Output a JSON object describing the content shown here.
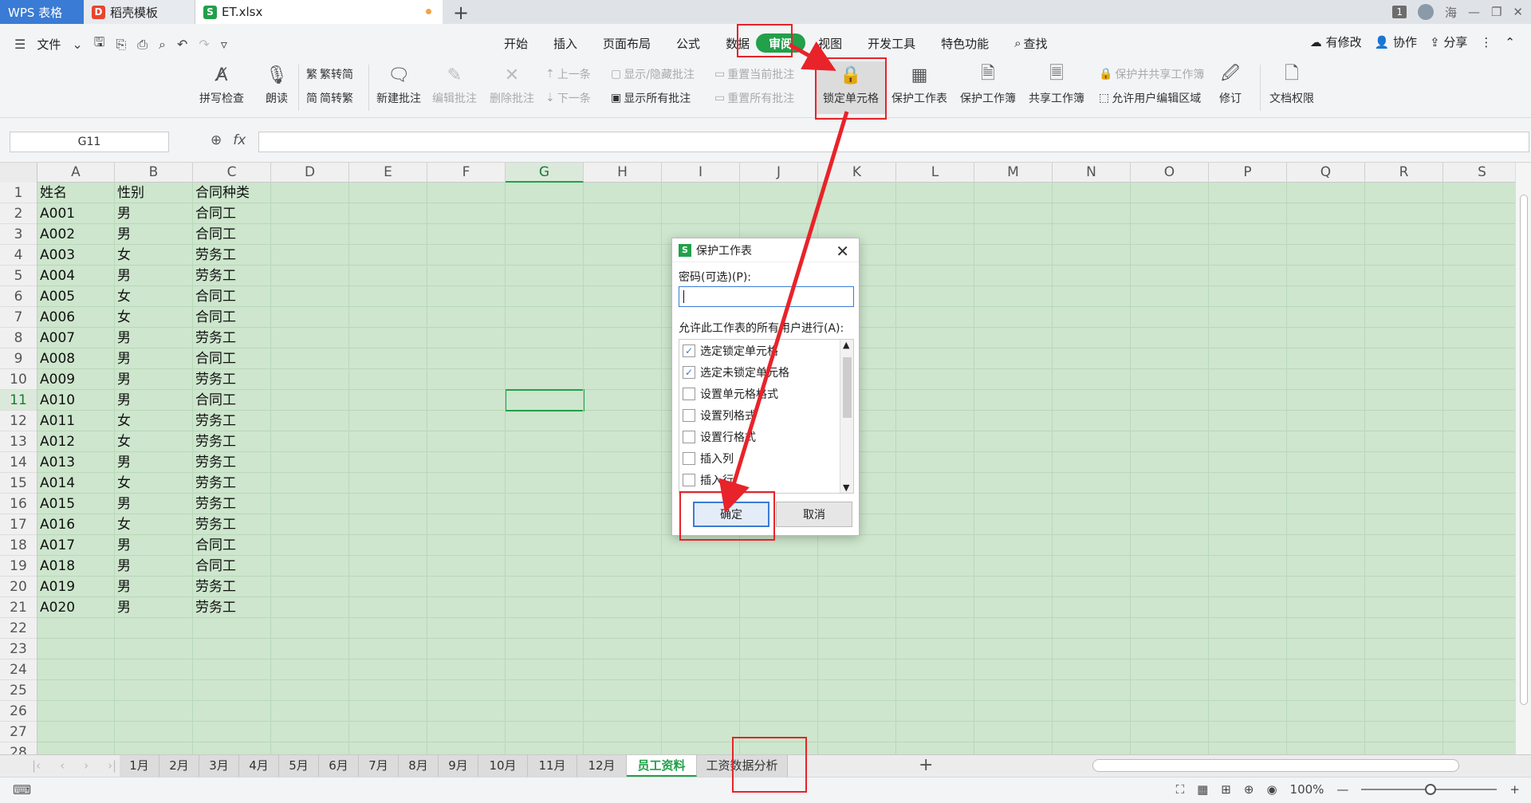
{
  "tabs": [
    {
      "label": "WPS 表格"
    },
    {
      "label": "稻壳模板"
    },
    {
      "label": "ET.xlsx"
    }
  ],
  "titlebar": {
    "window_badge": "1",
    "user": "海"
  },
  "menu": {
    "file": "文件",
    "tabs": [
      "开始",
      "插入",
      "页面布局",
      "公式",
      "数据",
      "审阅",
      "视图",
      "开发工具",
      "特色功能"
    ],
    "search": "查找",
    "right": [
      "有修改",
      "协作",
      "分享"
    ]
  },
  "ribbon": {
    "spell": "拼写检查",
    "read": "朗读",
    "trad": "繁转简",
    "simp": "简转繁",
    "new_comment": "新建批注",
    "edit_comment": "编辑批注",
    "delete_comment": "删除批注",
    "prev": "上一条",
    "next": "下一条",
    "show_hide": "显示/隐藏批注",
    "show_all": "显示所有批注",
    "reset_current": "重置当前批注",
    "reset_all": "重置所有批注",
    "lock_cell": "锁定单元格",
    "protect_sheet": "保护工作表",
    "protect_book": "保护工作簿",
    "share_book": "共享工作簿",
    "protect_share": "保护并共享工作簿",
    "allow_edit": "允许用户编辑区域",
    "revise": "修订",
    "doc_rights": "文档权限"
  },
  "formula": {
    "namebox": "G11",
    "fx": "fx"
  },
  "grid": {
    "columns": [
      "A",
      "B",
      "C",
      "D",
      "E",
      "F",
      "G",
      "H",
      "I",
      "J",
      "K",
      "L",
      "M",
      "N",
      "O",
      "P",
      "Q",
      "R",
      "S"
    ],
    "row_numbers": [
      "1",
      "2",
      "3",
      "4",
      "5",
      "6",
      "7",
      "8",
      "9",
      "10",
      "11",
      "12",
      "13",
      "14",
      "15",
      "16",
      "17",
      "18",
      "19",
      "20",
      "21",
      "22",
      "23",
      "24",
      "25",
      "26",
      "27",
      "28"
    ],
    "rows": [
      [
        "姓名",
        "性别",
        "合同种类"
      ],
      [
        "A001",
        "男",
        "合同工"
      ],
      [
        "A002",
        "男",
        "合同工"
      ],
      [
        "A003",
        "女",
        "劳务工"
      ],
      [
        "A004",
        "男",
        "劳务工"
      ],
      [
        "A005",
        "女",
        "合同工"
      ],
      [
        "A006",
        "女",
        "合同工"
      ],
      [
        "A007",
        "男",
        "劳务工"
      ],
      [
        "A008",
        "男",
        "合同工"
      ],
      [
        "A009",
        "男",
        "劳务工"
      ],
      [
        "A010",
        "男",
        "合同工"
      ],
      [
        "A011",
        "女",
        "劳务工"
      ],
      [
        "A012",
        "女",
        "劳务工"
      ],
      [
        "A013",
        "男",
        "劳务工"
      ],
      [
        "A014",
        "女",
        "劳务工"
      ],
      [
        "A015",
        "男",
        "劳务工"
      ],
      [
        "A016",
        "女",
        "劳务工"
      ],
      [
        "A017",
        "男",
        "合同工"
      ],
      [
        "A018",
        "男",
        "合同工"
      ],
      [
        "A019",
        "男",
        "劳务工"
      ],
      [
        "A020",
        "男",
        "劳务工"
      ]
    ]
  },
  "sheets": [
    "1月",
    "2月",
    "3月",
    "4月",
    "5月",
    "6月",
    "7月",
    "8月",
    "9月",
    "10月",
    "11月",
    "12月",
    "员工资料",
    "工资数据分析"
  ],
  "active_sheet": "员工资料",
  "status": {
    "zoom": "100%"
  },
  "dialog": {
    "title": "保护工作表",
    "password_label": "密码(可选)(P):",
    "allow_label": "允许此工作表的所有用户进行(A):",
    "permissions": [
      {
        "label": "选定锁定单元格",
        "checked": true
      },
      {
        "label": "选定未锁定单元格",
        "checked": true
      },
      {
        "label": "设置单元格格式",
        "checked": false
      },
      {
        "label": "设置列格式",
        "checked": false
      },
      {
        "label": "设置行格式",
        "checked": false
      },
      {
        "label": "插入列",
        "checked": false
      },
      {
        "label": "插入行",
        "checked": false
      }
    ],
    "ok": "确定",
    "cancel": "取消"
  },
  "colors": {
    "accent": "#22a04a",
    "grid_bg": "#cde6cd",
    "annotation": "#e8232a"
  }
}
